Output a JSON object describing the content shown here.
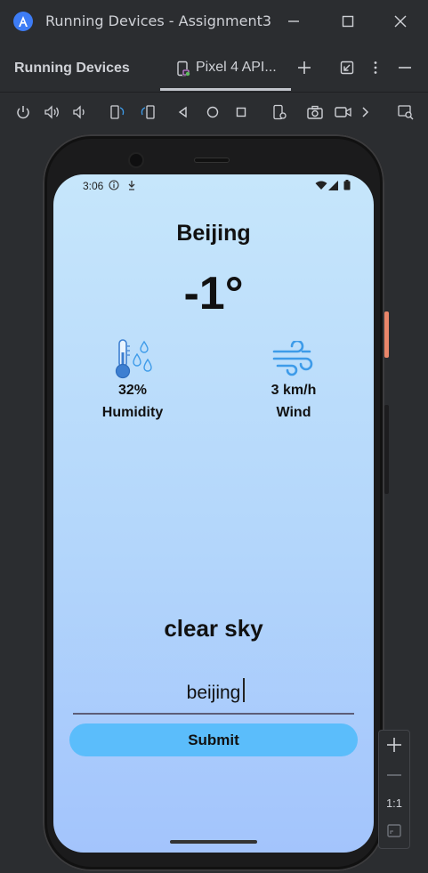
{
  "window": {
    "title": "Running Devices - Assignment3"
  },
  "tool_window": {
    "title": "Running Devices",
    "tab_label": "Pixel 4 API...",
    "icons": [
      "phone-device-icon",
      "plus-icon",
      "restore-icon",
      "more-icon",
      "minimize-icon"
    ]
  },
  "toolbar": {
    "icons": [
      "power-icon",
      "volume-up-icon",
      "volume-down-icon",
      "rotate-left-icon",
      "rotate-right-icon",
      "back-icon",
      "home-icon",
      "overview-icon",
      "device-settings-icon",
      "screenshot-icon",
      "screen-record-icon",
      "more-chevron-icon",
      "device-mirror-icon"
    ]
  },
  "device": {
    "status": {
      "time": "3:06"
    },
    "app": {
      "city": "Beijing",
      "temperature": "-1°",
      "humidity_value": "32%",
      "humidity_label": "Humidity",
      "wind_value": "3 km/h",
      "wind_label": "Wind",
      "description": "clear sky",
      "input_value": "beijing",
      "submit_label": "Submit"
    }
  },
  "zoom": {
    "reset_label": "1:1"
  },
  "colors": {
    "ide_bg": "#2b2d30",
    "screen_top": "#c6e6fb",
    "screen_bottom": "#a3c4fc",
    "submit_bg": "#5bbdfb",
    "icon_blue": "#3d9be9"
  }
}
